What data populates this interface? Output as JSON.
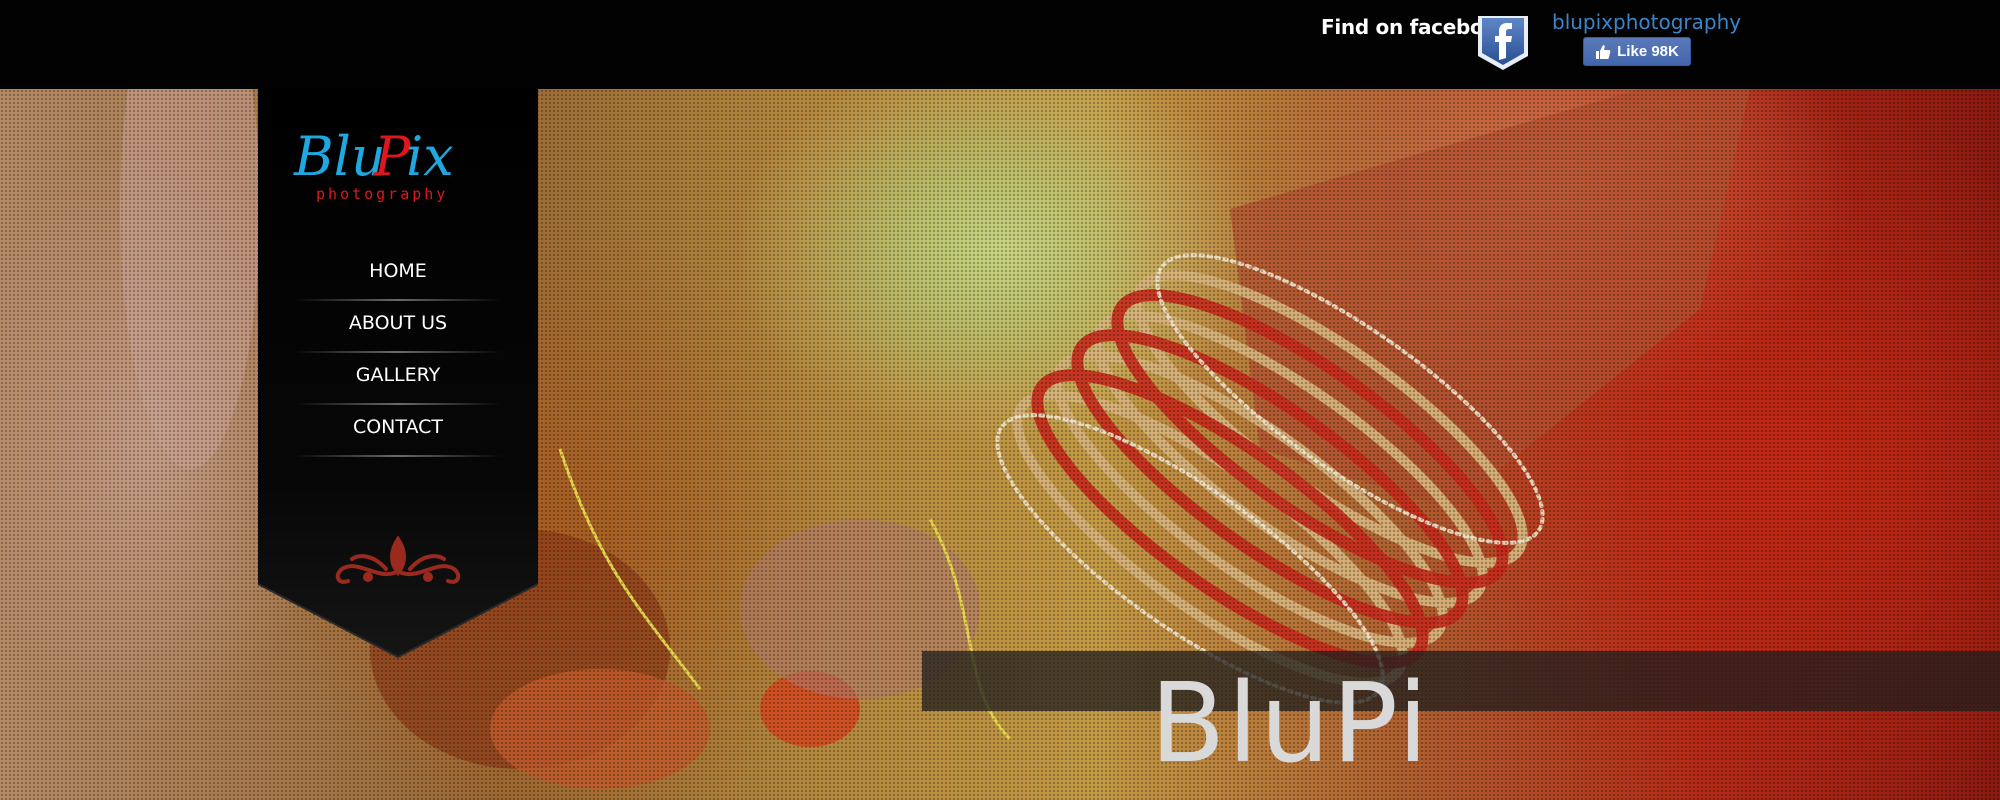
{
  "topbar": {
    "find_label": "Find on facebook",
    "facebook_badge_icon": "facebook-f-icon",
    "page_name": "blupixphotography",
    "like_label": "Like 98K"
  },
  "brand": {
    "logo_text": "BluPix",
    "logo_subtitle": "photography",
    "logo_colors": {
      "blu": "#1fa8e0",
      "pix": "#e0161d"
    }
  },
  "nav": {
    "items": [
      {
        "label": "HOME"
      },
      {
        "label": "ABOUT US"
      },
      {
        "label": "GALLERY"
      },
      {
        "label": "CONTACT"
      }
    ]
  },
  "hero": {
    "caption_text": "BluPi"
  },
  "colors": {
    "topbar_bg": "#020202",
    "facebook_blue": "#4266ad",
    "link_blue": "#3b86c9",
    "panel_bg": "#000000",
    "ornament": "#9a2a1e"
  }
}
